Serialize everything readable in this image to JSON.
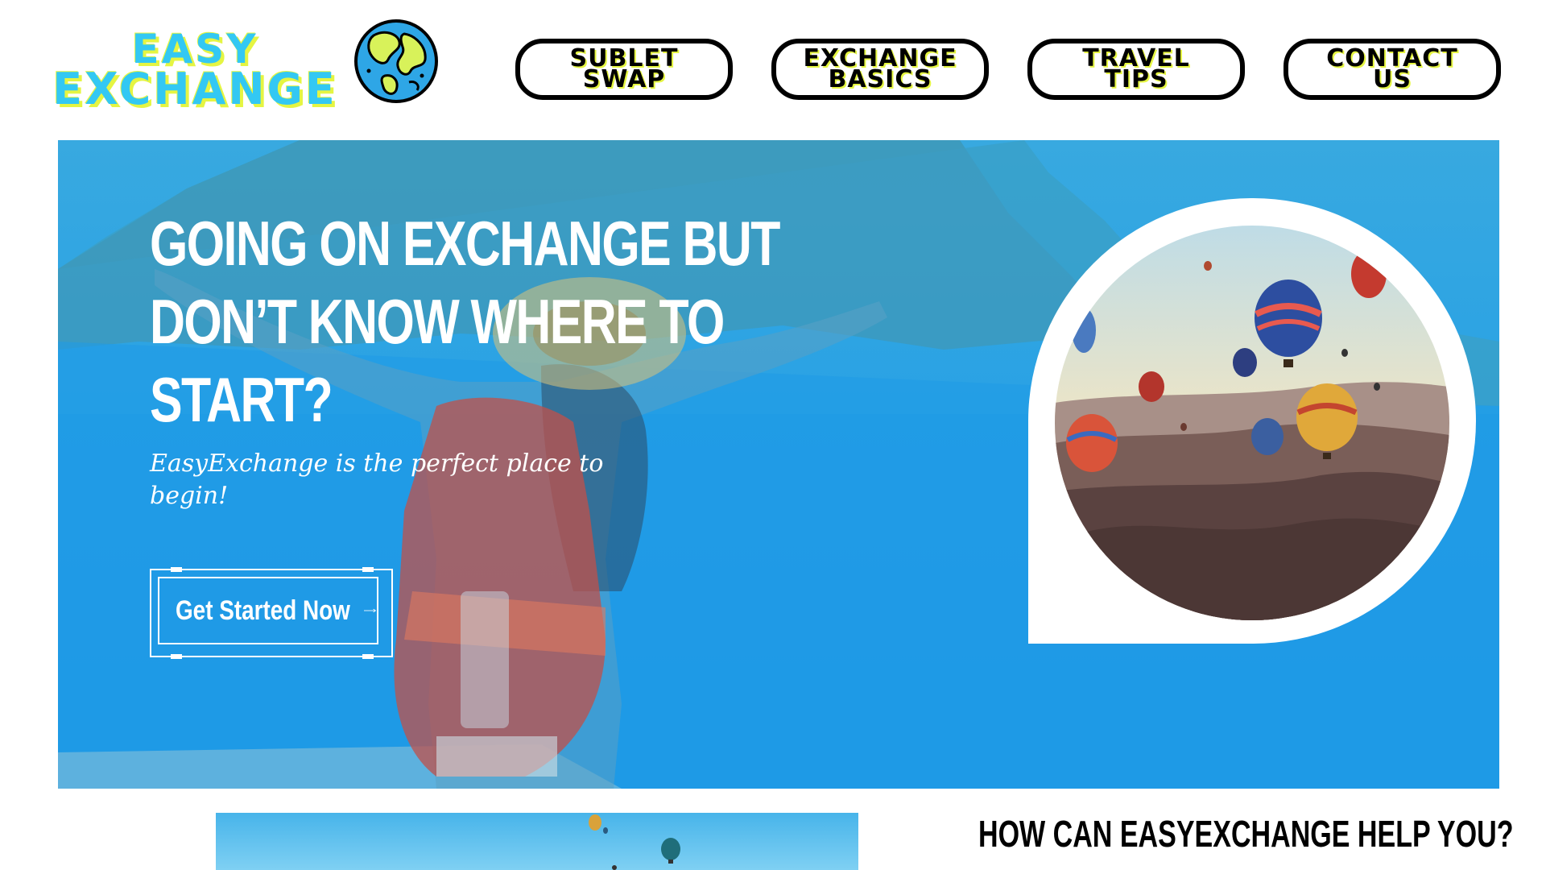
{
  "brand": {
    "line1": "EASY",
    "line2": "EXCHANGE",
    "primary_color": "#33c8f3",
    "shadow_color": "#e5f542",
    "logo_icon": "globe-icon"
  },
  "nav": {
    "items": [
      {
        "label": "SUBLET SWAP"
      },
      {
        "label": "EXCHANGE BASICS"
      },
      {
        "label": "TRAVEL TIPS"
      },
      {
        "label": "CONTACT US"
      }
    ]
  },
  "hero": {
    "title_lines": [
      "GOING ON EXCHANGE BUT",
      "DON’T KNOW WHERE TO",
      "START?"
    ],
    "subtitle": "EasyExchange is the perfect place to begin!",
    "cta_label": "Get Started Now",
    "cta_icon": "arrow-right-icon",
    "overlay_color": "#2aa2e4"
  },
  "section": {
    "heading": "HOW CAN EASYEXCHANGE HELP YOU?"
  }
}
